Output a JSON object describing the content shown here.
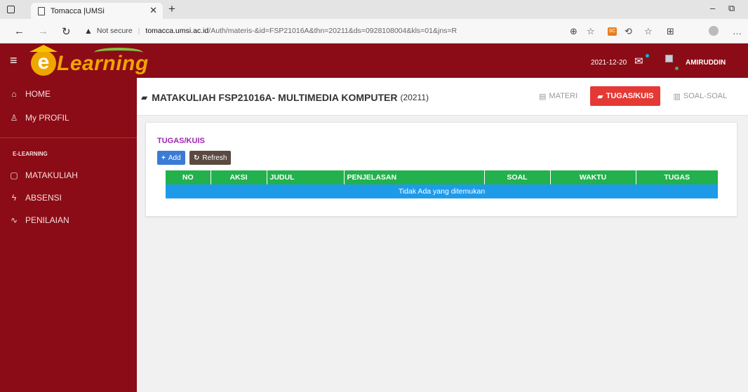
{
  "browser": {
    "tab_title": "Tomacca |UMSi",
    "security": "Not secure",
    "url_host": "tomacca.umsi.ac.id",
    "url_path": "/Auth/materis-&id=FSP21016A&thn=20211&ds=0928108004&kls=01&jns=R",
    "extension_badge": "SC"
  },
  "header": {
    "logo_e": "e",
    "logo_text": "Learning",
    "date": "2021-12-20",
    "username": "AMIRUDDIN"
  },
  "sidebar": {
    "items_top": [
      {
        "label": "HOME",
        "icon": "home-icon"
      },
      {
        "label": "My PROFIL",
        "icon": "user-icon"
      }
    ],
    "section": "E-LEARNING",
    "items": [
      {
        "label": "MATAKULIAH",
        "icon": "file-icon"
      },
      {
        "label": "ABSENSI",
        "icon": "bolt-icon"
      },
      {
        "label": "PENILAIAN",
        "icon": "pulse-icon"
      }
    ]
  },
  "page": {
    "title": "MATAKULIAH FSP21016A- MULTIMEDIA KOMPUTER",
    "semester": "(20211)",
    "tabs": [
      "MATERI",
      "TUGAS/KUIS",
      "SOAL-SOAL"
    ],
    "active_tab": "TUGAS/KUIS"
  },
  "panel": {
    "title": "TUGAS/KUIS",
    "add_label": "Add",
    "refresh_label": "Refresh",
    "columns": [
      "NO",
      "AKSI",
      "JUDUL",
      "PENJELASAN",
      "SOAL",
      "WAKTU",
      "TUGAS"
    ],
    "empty_message": "Tidak Ada yang ditemukan"
  },
  "colors": {
    "brand": "#8b0c16",
    "active_tab": "#e53935",
    "table_header": "#22b14c",
    "empty_row": "#1e9be8"
  }
}
